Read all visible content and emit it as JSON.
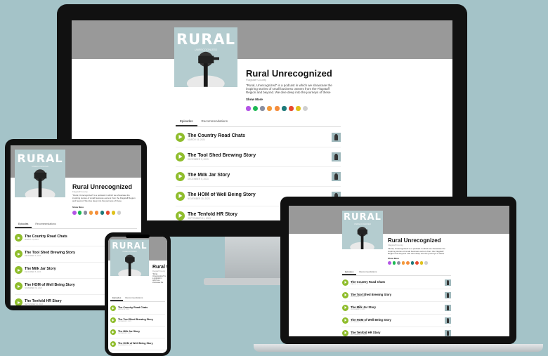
{
  "podcast": {
    "cover_text": "RURAL",
    "cover_subtitle": "UNRECOGNIZED",
    "title": "Rural Unrecognized",
    "author": "Flagstaff County",
    "description": "\"Rural, Unrecognized\" is a podcast in which we showcase the inspiring stories of small business owners from the Flagstaff Region and beyond. We dive deep into the journeys of these",
    "show_more": "Show More"
  },
  "tabs": [
    "Episodes",
    "Recommendations"
  ],
  "episodes": [
    {
      "title": "The Country Road Chats",
      "date": "MARCH 14, 2024"
    },
    {
      "title": "The Tool Shed Brewing Story",
      "date": "DECEMBER 9, 2023"
    },
    {
      "title": "The Milk Jar Story",
      "date": "DECEMBER 5, 2023"
    },
    {
      "title": "The HOM of Well Being Story",
      "date": "NOVEMBER 30, 2023"
    },
    {
      "title": "The Tenfold HR Story",
      "date": "SEPTEMBER 21, 2023"
    }
  ],
  "platform_icons": [
    {
      "name": "apple-podcasts-icon",
      "color": "#b455e6"
    },
    {
      "name": "spotify-icon",
      "color": "#1db954"
    },
    {
      "name": "rss-feed-icon",
      "color": "#8a8fa0"
    },
    {
      "name": "podcast-addict-icon",
      "color": "#f39a3b"
    },
    {
      "name": "overcast-icon",
      "color": "#f58d3c"
    },
    {
      "name": "pocket-casts-icon",
      "color": "#1e7a7a"
    },
    {
      "name": "castbox-icon",
      "color": "#e84a2f"
    },
    {
      "name": "player-fm-icon",
      "color": "#e0c21c"
    },
    {
      "name": "more-icon",
      "color": "#cfcfcf"
    }
  ],
  "colors": {
    "accent": "#8fbd2c",
    "backdrop": "#a4c3c8",
    "banner": "#999999"
  }
}
